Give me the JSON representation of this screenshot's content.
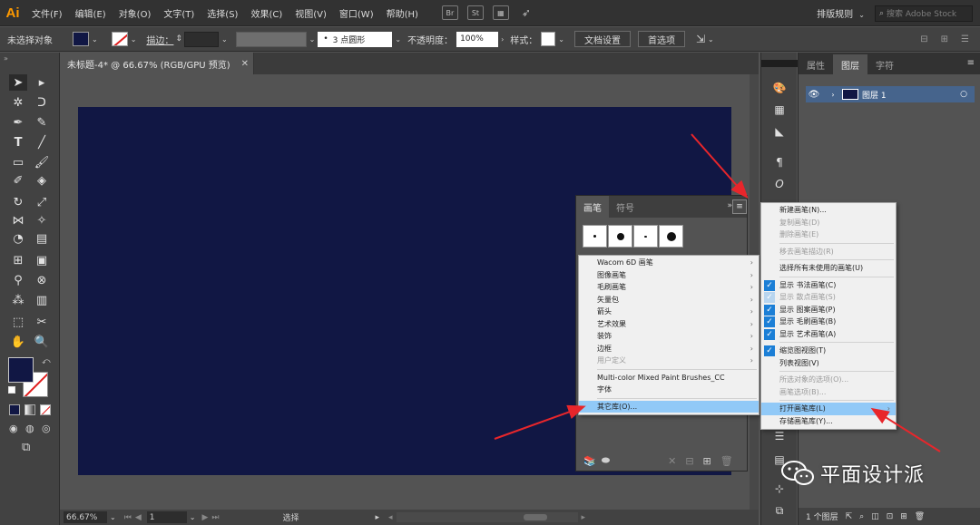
{
  "menubar": {
    "logo": "Ai",
    "items": [
      "文件(F)",
      "编辑(E)",
      "对象(O)",
      "文字(T)",
      "选择(S)",
      "效果(C)",
      "视图(V)",
      "窗口(W)",
      "帮助(H)"
    ],
    "icons": [
      {
        "name": "bridge-icon",
        "label": "Br"
      },
      {
        "name": "stock-icon",
        "label": "St"
      }
    ],
    "arrange_label": "排版规则",
    "search_placeholder": "搜索 Adobe Stock"
  },
  "control": {
    "selection_status": "未选择对象",
    "fill_color": "#111744",
    "stroke_label": "描边：",
    "brush_value": "3 点圆形",
    "opacity_label": "不透明度：",
    "opacity_value": "100%",
    "style_label": "样式：",
    "doc_setup_button": "文档设置",
    "prefs_button": "首选项"
  },
  "document": {
    "tab_title": "未标题-4* @ 66.67% (RGB/GPU 预览)",
    "close": "✕",
    "artboard_color": "#111744"
  },
  "status": {
    "zoom": "66.67%",
    "page": "1",
    "state": "选择"
  },
  "brushes_panel": {
    "tabs": [
      "画笔",
      "符号"
    ],
    "collapse": "»",
    "menu_icon": "≡"
  },
  "library_menu": {
    "items": [
      {
        "label": "Wacom 6D 画笔",
        "sub": true,
        "disabled": false
      },
      {
        "label": "图像画笔",
        "sub": true,
        "disabled": false
      },
      {
        "label": "毛刷画笔",
        "sub": true,
        "disabled": false
      },
      {
        "label": "矢量包",
        "sub": true,
        "disabled": false
      },
      {
        "label": "箭头",
        "sub": true,
        "disabled": false
      },
      {
        "label": "艺术效果",
        "sub": true,
        "disabled": false
      },
      {
        "label": "装饰",
        "sub": true,
        "disabled": false
      },
      {
        "label": "边框",
        "sub": true,
        "disabled": false
      },
      {
        "label": "用户定义",
        "sub": true,
        "disabled": true
      }
    ],
    "extra": [
      {
        "label": "Multi-color Mixed Paint Brushes_CC"
      },
      {
        "label": "字体"
      }
    ],
    "other": {
      "label": "其它库(O)..."
    }
  },
  "flyout_menu": {
    "group1": [
      {
        "label": "新建画笔(N)...",
        "disabled": false
      },
      {
        "label": "复制画笔(D)",
        "disabled": true
      },
      {
        "label": "删除画笔(E)",
        "disabled": true
      }
    ],
    "group2": [
      {
        "label": "移去画笔描边(R)",
        "disabled": true
      }
    ],
    "group3": [
      {
        "label": "选择所有未使用的画笔(U)",
        "disabled": false
      }
    ],
    "group4": [
      {
        "label": "显示 书法画笔(C)",
        "checked": true,
        "disabled": false
      },
      {
        "label": "显示 散点画笔(S)",
        "checked": true,
        "disabled": true
      },
      {
        "label": "显示 图案画笔(P)",
        "checked": true,
        "disabled": false
      },
      {
        "label": "显示 毛刷画笔(B)",
        "checked": true,
        "disabled": false
      },
      {
        "label": "显示 艺术画笔(A)",
        "checked": true,
        "disabled": false
      }
    ],
    "group5": [
      {
        "label": "缩览图视图(T)",
        "checked": true
      },
      {
        "label": "列表视图(V)",
        "checked": false
      }
    ],
    "group6": [
      {
        "label": "所选对象的选项(O)...",
        "disabled": true
      },
      {
        "label": "画笔选项(B)...",
        "disabled": true
      }
    ],
    "group7": [
      {
        "label": "打开画笔库(L)",
        "sub": true,
        "highlight": true
      },
      {
        "label": "存储画笔库(Y)...",
        "sub": false,
        "highlight": false
      }
    ]
  },
  "layers_panel": {
    "tabs": [
      "属性",
      "图层",
      "字符"
    ],
    "active_tab": 1,
    "layer_name": "图层 1",
    "footer": "1 个图层"
  },
  "watermark": {
    "text": "平面设计派"
  },
  "colors": {
    "accent_red": "#e8262b",
    "menu_highlight": "#91c9f7",
    "layer_selected": "#46648c"
  }
}
